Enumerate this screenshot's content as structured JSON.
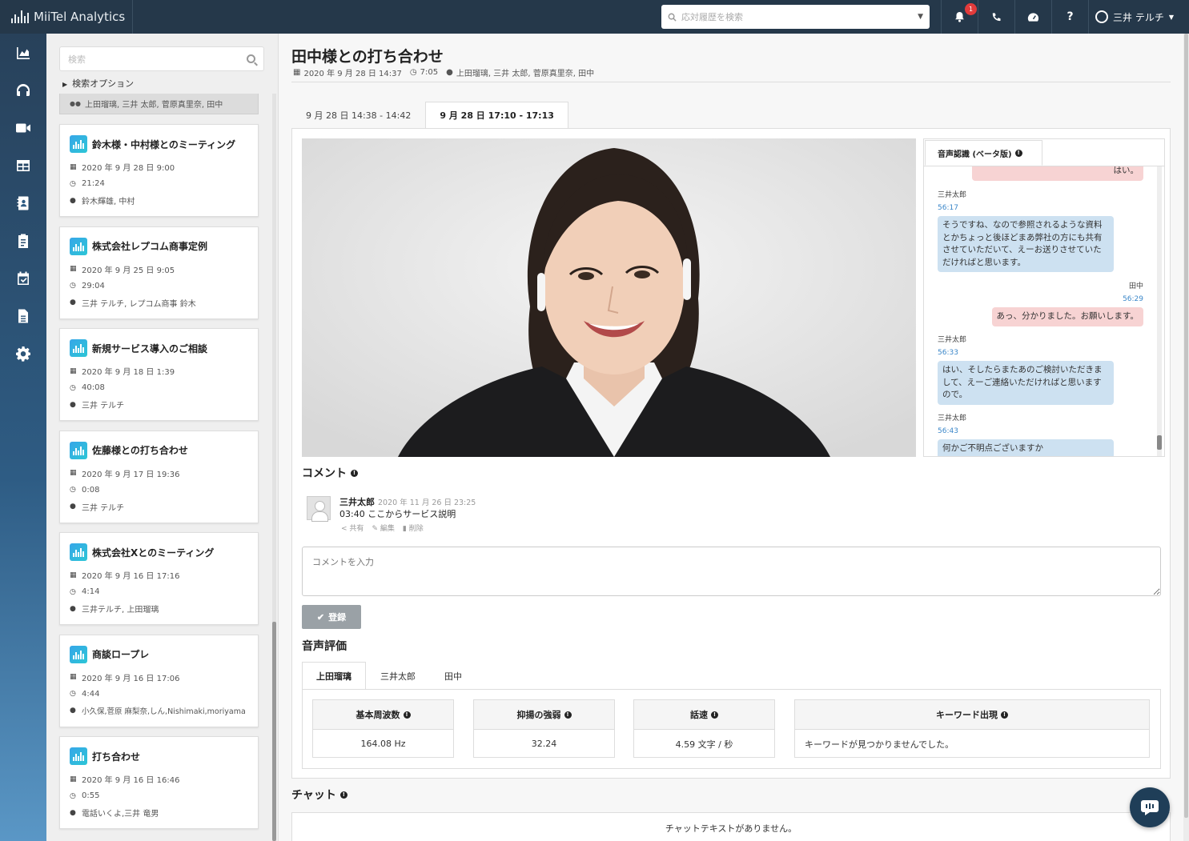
{
  "app": {
    "name": "MiiTel Analytics",
    "search_placeholder": "応対履歴を検索",
    "notification_count": "1",
    "user_name": "三井 テルチ"
  },
  "nav": {
    "items": [
      "analytics-icon",
      "headset-icon",
      "video-icon",
      "table-icon",
      "contacts-icon",
      "clipboard-icon",
      "calendar-check-icon",
      "document-icon",
      "gear-icon"
    ]
  },
  "list": {
    "search_placeholder": "検索",
    "search_options": "検索オプション",
    "partial_participants": "上田瑠璃, 三井 太郎, 菅原真里奈, 田中",
    "cards": [
      {
        "title": "鈴木様・中村様とのミーティング",
        "date": "2020 年 9 月 28 日 9:00",
        "duration": "21:24",
        "participants": "鈴木輝雄, 中村"
      },
      {
        "title": "株式会社レプコム商事定例",
        "date": "2020 年 9 月 25 日 9:05",
        "duration": "29:04",
        "participants": "三井 テルチ, レプコム商事 鈴木"
      },
      {
        "title": "新規サービス導入のご相談",
        "date": "2020 年 9 月 18 日 1:39",
        "duration": "40:08",
        "participants": "三井 テルチ"
      },
      {
        "title": "佐藤様との打ち合わせ",
        "date": "2020 年 9 月 17 日 19:36",
        "duration": "0:08",
        "participants": "三井 テルチ"
      },
      {
        "title": "株式会社Xとのミーティング",
        "date": "2020 年 9 月 16 日 17:16",
        "duration": "4:14",
        "participants": "三井テルチ, 上田瑠璃"
      },
      {
        "title": "商談ロープレ",
        "date": "2020 年 9 月 16 日 17:06",
        "duration": "4:44",
        "participants": "小久保,菅原 麻梨奈,しん,Nishimaki,moriyama"
      },
      {
        "title": "打ち合わせ",
        "date": "2020 年 9 月 16 日 16:46",
        "duration": "0:55",
        "participants": "電話いくよ,三井 竜男"
      }
    ]
  },
  "meeting": {
    "title": "田中様との打ち合わせ",
    "date": "2020 年 9 月 28 日 14:37",
    "duration": "7:05",
    "participants": "上田瑠璃, 三井 太郎, 菅原真里奈, 田中",
    "tabs": [
      "9 月 28 日 14:38 - 14:42",
      "9 月 28 日 17:10 - 17:13"
    ]
  },
  "transcript": {
    "tab_label": "音声認識 (ベータ版)",
    "messages": [
      {
        "speaker": "",
        "time": "",
        "text": "はい。",
        "side": "right"
      },
      {
        "speaker": "三井太郎",
        "time": "56:17",
        "text": "そうですね、なので参照されるような資料とかちょっと後ほどまあ弊社の方にも共有させていただいて、えーお送りさせていただければと思います。",
        "side": "left"
      },
      {
        "speaker": "田中",
        "time": "56:29",
        "text": "あっ、分かりました。お願いします。",
        "side": "right"
      },
      {
        "speaker": "三井太郎",
        "time": "56:33",
        "text": "はい、そしたらまたあのご検討いただきまして、えーご連絡いただければと思いますので。",
        "side": "left"
      },
      {
        "speaker": "三井太郎",
        "time": "56:43",
        "text": "何かご不明点ございますか",
        "side": "left"
      }
    ]
  },
  "comments": {
    "heading": "コメント",
    "items": [
      {
        "author": "三井太郎",
        "date": "2020 年 11 月 26 日 23:25",
        "text": "03:40 ここからサービス説明",
        "actions": [
          "共有",
          "編集",
          "削除"
        ]
      }
    ],
    "input_placeholder": "コメントを入力",
    "submit_label": "登録"
  },
  "voice_eval": {
    "heading": "音声評価",
    "tabs": [
      "上田瑠璃",
      "三井太郎",
      "田中"
    ],
    "metrics": [
      {
        "label": "基本周波数",
        "value": "164.08 Hz"
      },
      {
        "label": "抑揚の強弱",
        "value": "32.24"
      },
      {
        "label": "話速",
        "value": "4.59 文字 / 秒"
      },
      {
        "label": "キーワード出現",
        "value": "キーワードが見つかりませんでした。"
      }
    ]
  },
  "chat": {
    "heading": "チャット",
    "empty": "チャットテキストがありません。"
  },
  "colors": {
    "topbar": "#25384a",
    "accent": "#37a6e8",
    "bubble_blue": "#cde1f1",
    "bubble_pink": "#f7d3d3"
  }
}
